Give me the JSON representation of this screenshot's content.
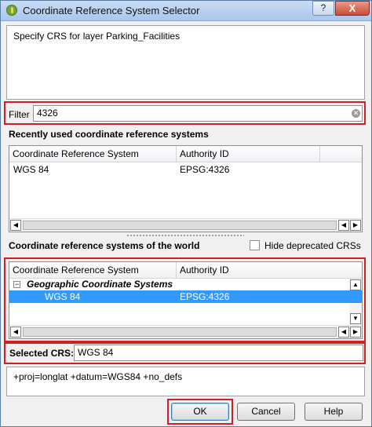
{
  "window": {
    "title": "Coordinate Reference System Selector",
    "help_glyph": "?",
    "close_glyph": "X"
  },
  "description": "Specify CRS for layer Parking_Facilities",
  "filter": {
    "label": "Filter",
    "value": "4326"
  },
  "recent": {
    "title": "Recently used coordinate reference systems",
    "columns": [
      "Coordinate Reference System",
      "Authority ID"
    ],
    "rows": [
      {
        "name": "WGS 84",
        "authid": "EPSG:4326"
      }
    ]
  },
  "world": {
    "title": "Coordinate reference systems of the world",
    "hide_deprecated": {
      "label": "Hide deprecated CRSs",
      "checked": false
    },
    "columns": [
      "Coordinate Reference System",
      "Authority ID"
    ],
    "group": {
      "label": "Geographic Coordinate Systems",
      "toggle": "−"
    },
    "rows": [
      {
        "name": "WGS 84",
        "authid": "EPSG:4326",
        "selected": true
      }
    ]
  },
  "selected_crs": {
    "label": "Selected CRS:",
    "value": "WGS 84"
  },
  "proj_string": "+proj=longlat +datum=WGS84 +no_defs",
  "buttons": {
    "ok": "OK",
    "cancel": "Cancel",
    "help": "Help"
  },
  "scroll_glyphs": {
    "left": "◀",
    "right": "▶",
    "up": "▲",
    "down": "▼"
  },
  "colors": {
    "highlight": "#d11f24",
    "selection": "#3399ff"
  }
}
